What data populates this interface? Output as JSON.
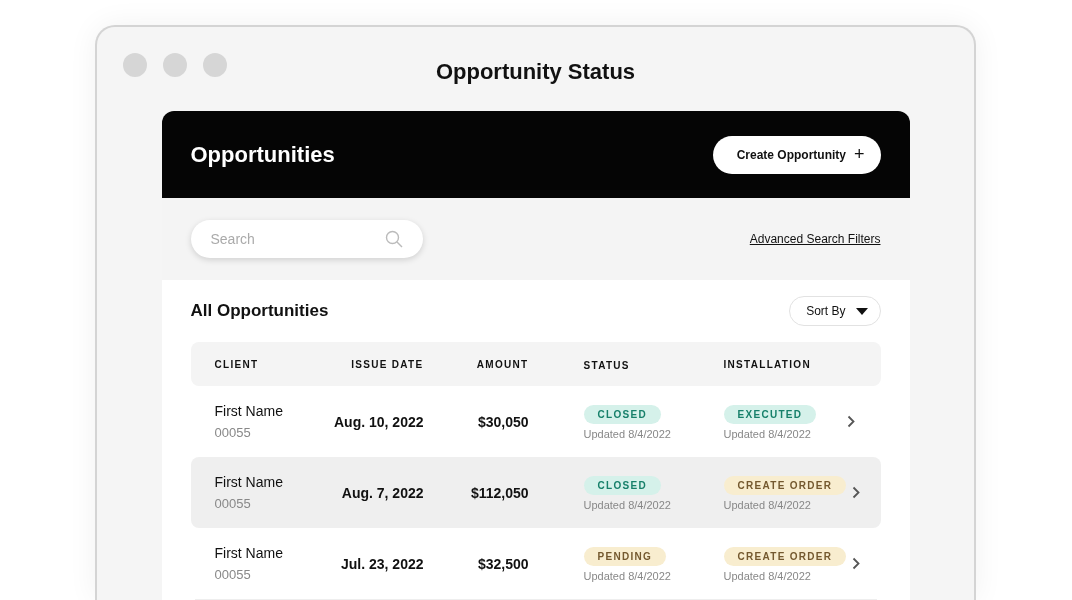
{
  "window": {
    "title": "Opportunity Status"
  },
  "header": {
    "title": "Opportunities",
    "create_button": "Create Opportunity",
    "create_icon": "+"
  },
  "search": {
    "placeholder": "Search"
  },
  "advanced_link": "Advanced Search Filters",
  "list": {
    "title": "All Opportunities",
    "sort_button": "Sort By"
  },
  "table": {
    "columns": [
      "CLIENT",
      "ISSUE DATE",
      "AMOUNT",
      "STATUS",
      "INSTALLATION"
    ],
    "rows": [
      {
        "client": "First Name",
        "client_id": "00055",
        "issue_date": "Aug. 10, 2022",
        "amount": "$30,050",
        "status": {
          "label": "CLOSED",
          "kind": "positive",
          "updated": "Updated 8/4/2022"
        },
        "installation": {
          "label": "EXECUTED",
          "kind": "positive",
          "updated": "Updated 8/4/2022"
        },
        "selected": false
      },
      {
        "client": "First Name",
        "client_id": "00055",
        "issue_date": "Aug. 7, 2022",
        "amount": "$112,050",
        "status": {
          "label": "CLOSED",
          "kind": "positive",
          "updated": "Updated 8/4/2022"
        },
        "installation": {
          "label": "CREATE ORDER",
          "kind": "attention",
          "updated": "Updated 8/4/2022"
        },
        "selected": true
      },
      {
        "client": "First Name",
        "client_id": "00055",
        "issue_date": "Jul. 23, 2022",
        "amount": "$32,500",
        "status": {
          "label": "PENDING",
          "kind": "attention",
          "updated": "Updated 8/4/2022"
        },
        "installation": {
          "label": "CREATE ORDER",
          "kind": "attention",
          "updated": "Updated 8/4/2022"
        },
        "selected": false
      }
    ]
  }
}
